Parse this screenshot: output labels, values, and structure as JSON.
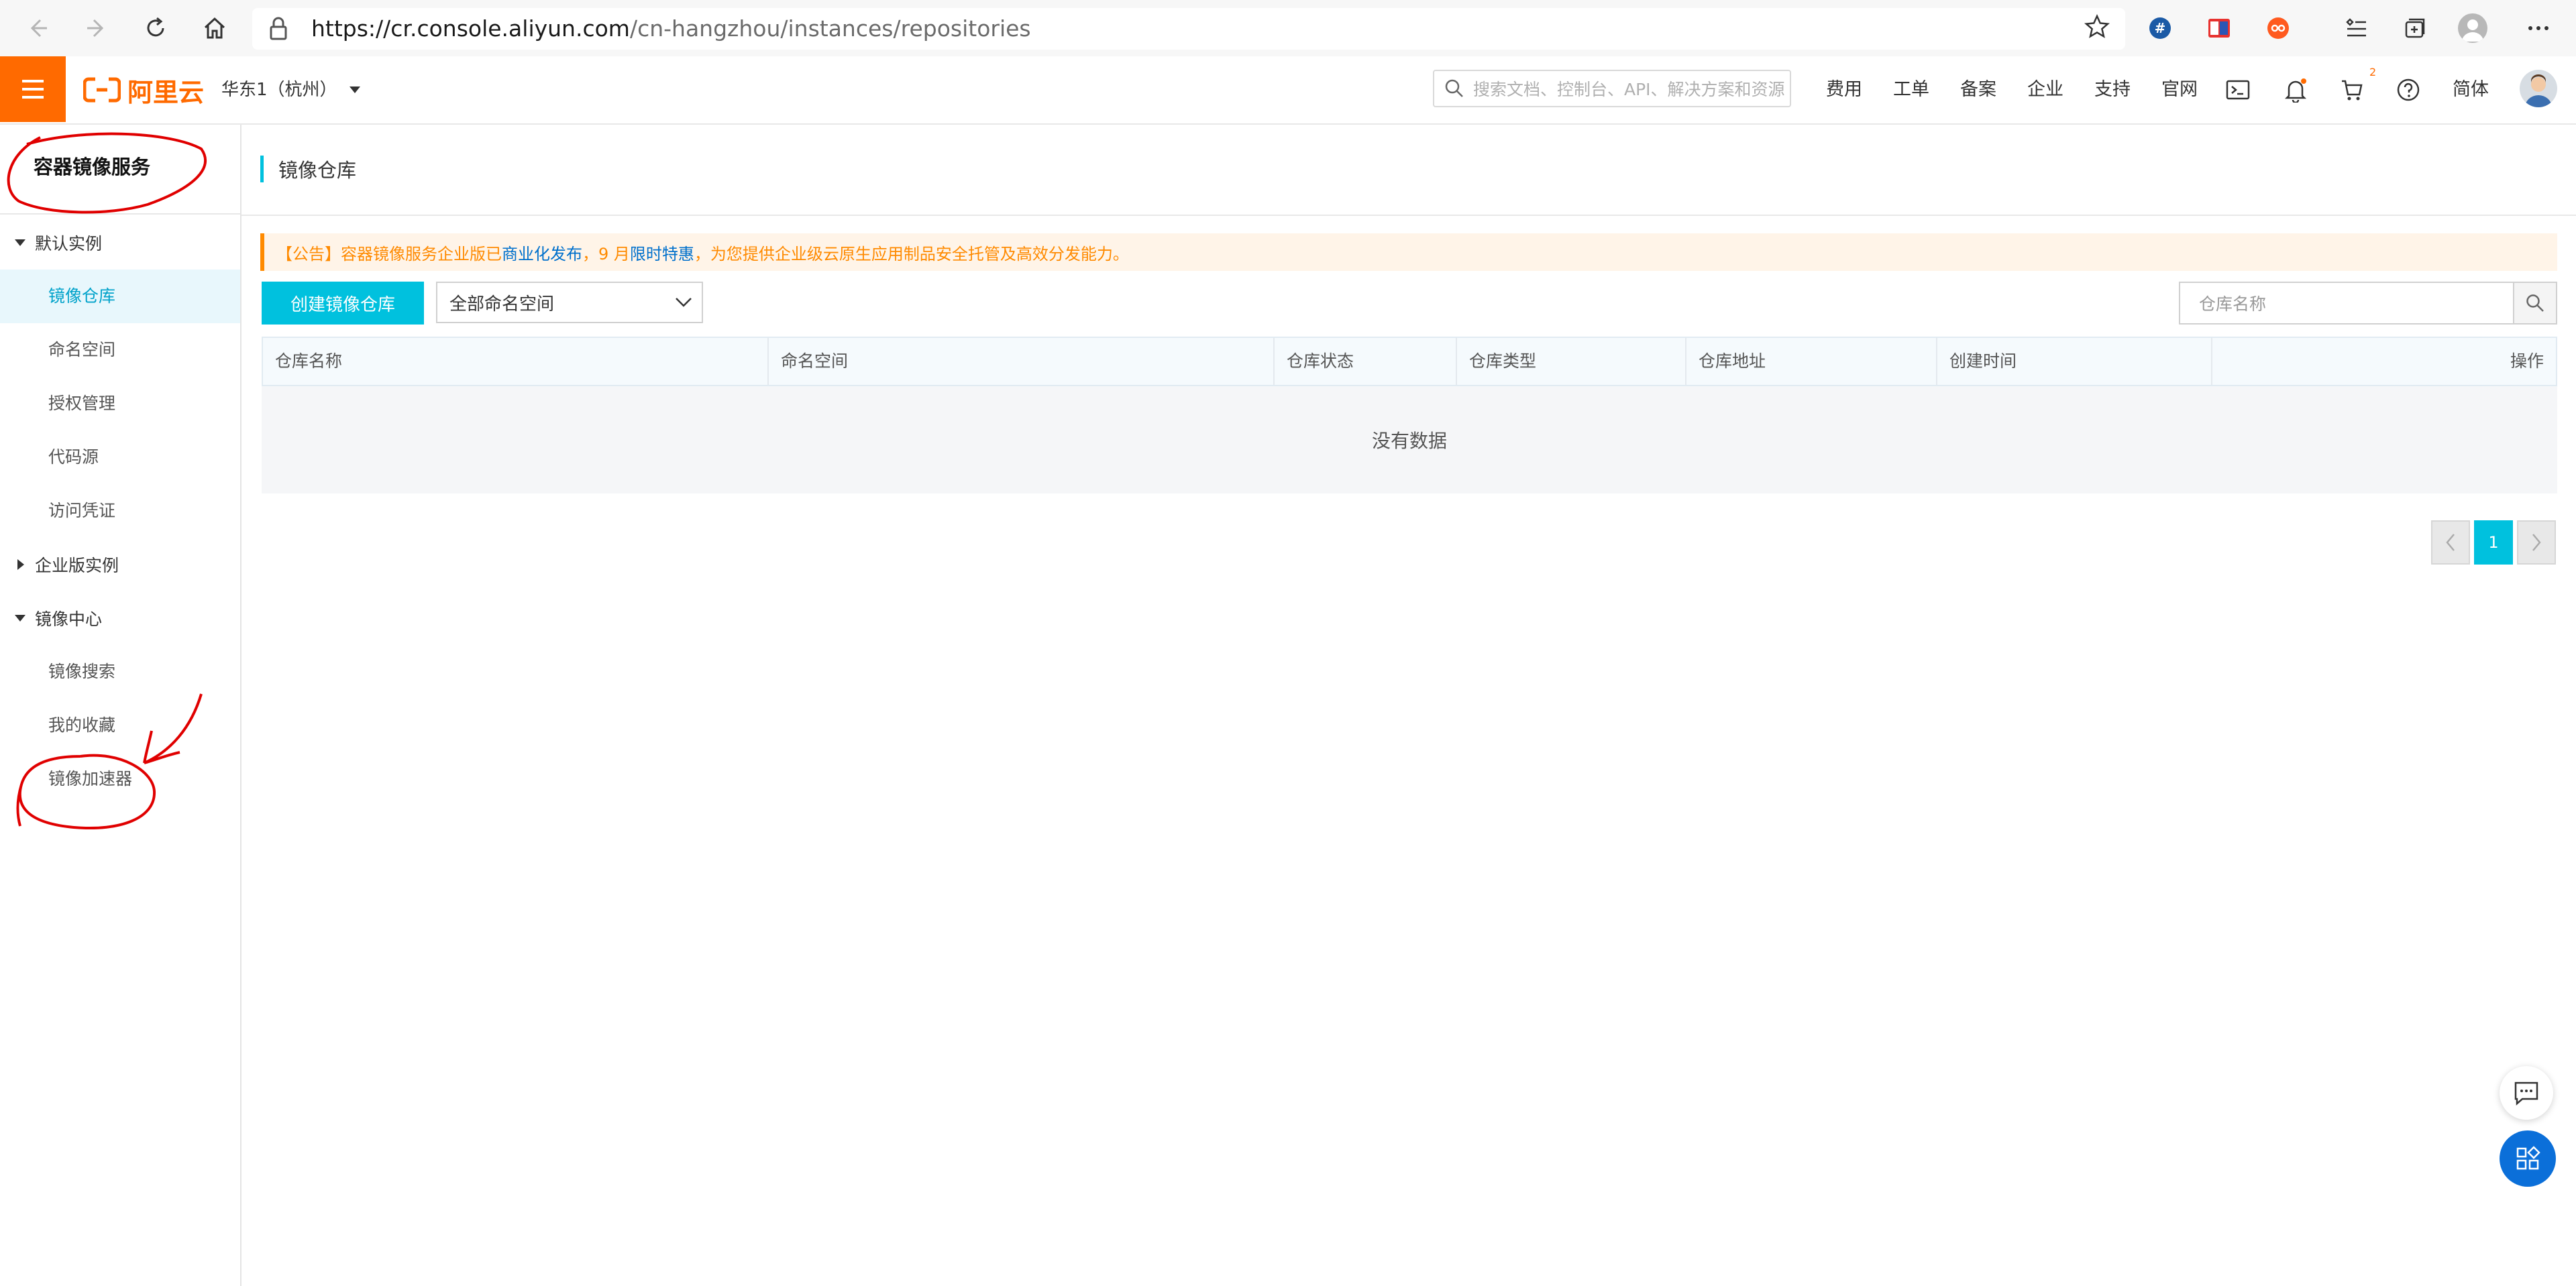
{
  "browser": {
    "url_host": "https://cr.console.aliyun.com",
    "url_path": "/cn-hangzhou/instances/repositories"
  },
  "header": {
    "logo_text": "阿里云",
    "region": "华东1（杭州）",
    "search_placeholder": "搜索文档、控制台、API、解决方案和资源",
    "nav": [
      "费用",
      "工单",
      "备案",
      "企业",
      "支持",
      "官网"
    ],
    "cart_badge": "2",
    "language": "简体"
  },
  "sidebar": {
    "title": "容器镜像服务",
    "groups": [
      {
        "label": "默认实例",
        "expanded": true,
        "items": [
          "镜像仓库",
          "命名空间",
          "授权管理",
          "代码源",
          "访问凭证"
        ]
      },
      {
        "label": "企业版实例",
        "expanded": false,
        "items": []
      },
      {
        "label": "镜像中心",
        "expanded": true,
        "items": [
          "镜像搜索",
          "我的收藏",
          "镜像加速器"
        ]
      }
    ],
    "active_item": "镜像仓库"
  },
  "main": {
    "title": "镜像仓库",
    "notice": {
      "part1": "【公告】容器镜像服务企业版已",
      "link1": "商业化发布",
      "part2": "，9 月",
      "link2": "限时特惠",
      "part3": "，为您提供企业级云原生应用制品安全托管及高效分发能力。"
    },
    "create_button": "创建镜像仓库",
    "namespace_select": "全部命名空间",
    "search_placeholder": "仓库名称",
    "columns": [
      "仓库名称",
      "命名空间",
      "仓库状态",
      "仓库类型",
      "仓库地址",
      "创建时间",
      "操作"
    ],
    "empty_text": "没有数据",
    "pagination": {
      "current": "1"
    }
  },
  "colors": {
    "brand": "#ff6a00",
    "accent": "#00c1de",
    "notice_text": "#ff8a00",
    "link": "#0070cc",
    "annotation": "#e00000"
  }
}
